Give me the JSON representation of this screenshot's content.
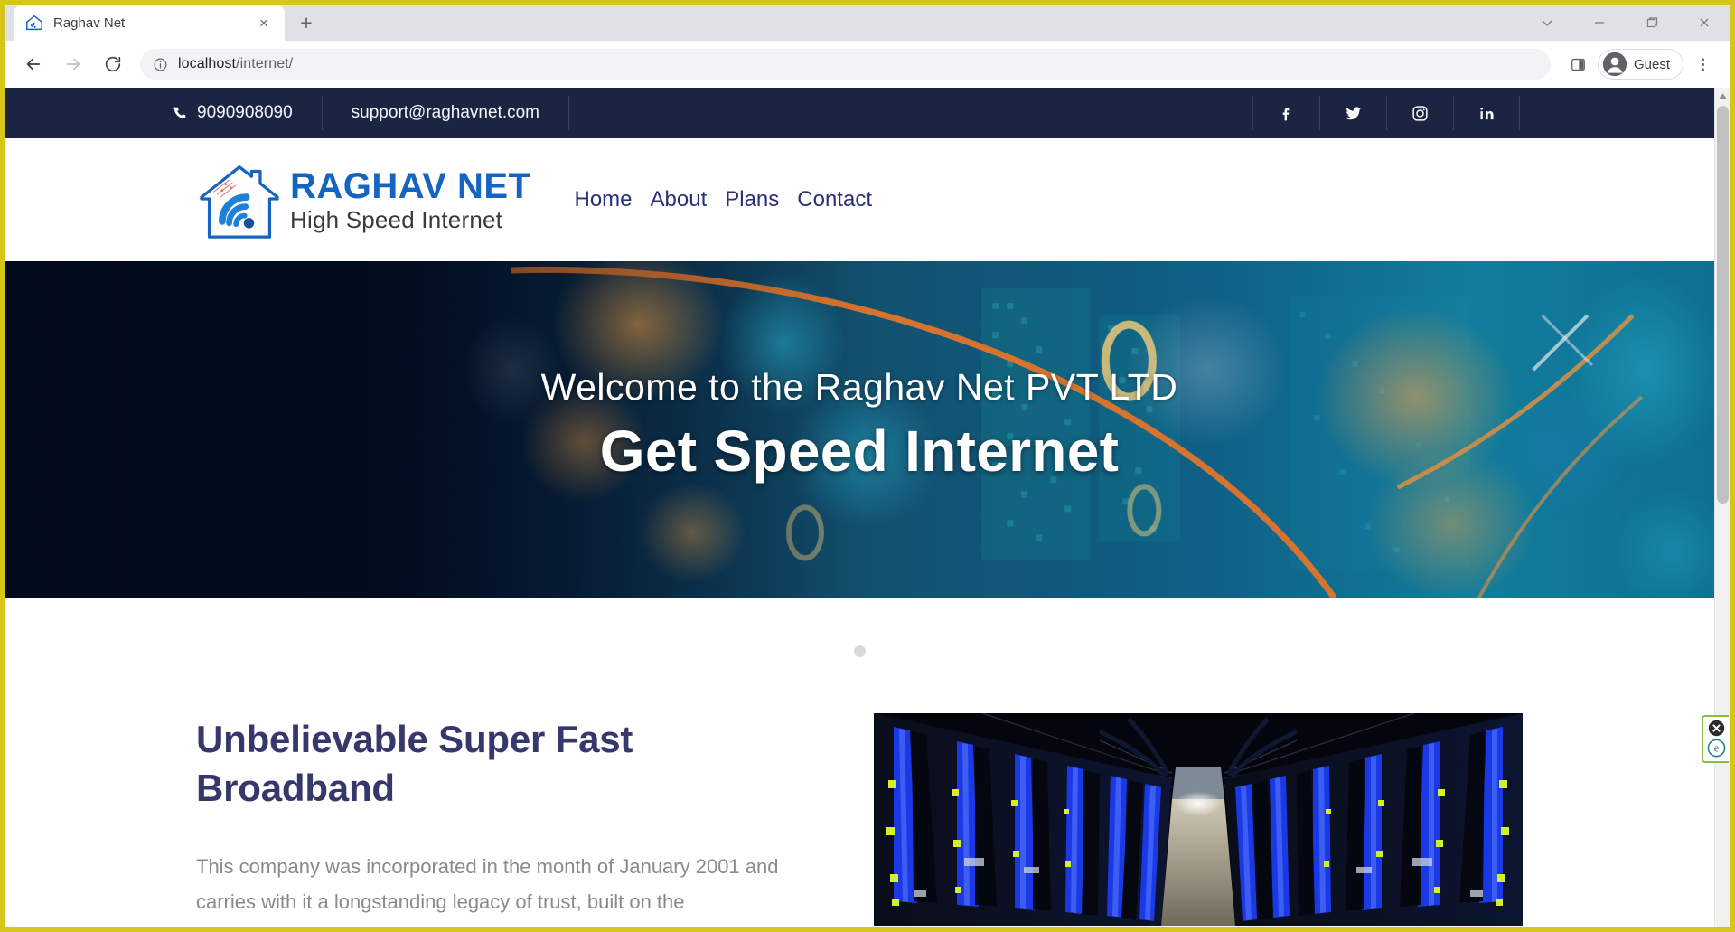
{
  "browser": {
    "tab": {
      "title": "Raghav Net",
      "favicon": "house-wifi-icon",
      "close": "×"
    },
    "new_tab_label": "+",
    "window_controls": {
      "minimize_group": "chevron-down",
      "minimize": "minimize",
      "maximize": "maximize",
      "close": "close"
    },
    "nav": {
      "back": "back-arrow",
      "forward": "forward-arrow",
      "reload": "reload-arrow"
    },
    "omnibox": {
      "info_icon": "info-circle-icon",
      "url_host": "localhost",
      "url_path": "/internet/",
      "url_full": "localhost/internet/"
    },
    "side_panel_icon": "side-panel-icon",
    "profile": {
      "label": "Guest",
      "avatar": "person-avatar"
    },
    "menu_icon": "three-dot-menu-icon"
  },
  "site": {
    "topbar": {
      "phone": "9090908090",
      "phone_icon": "phone-icon",
      "email": "support@raghavnet.com",
      "socials": [
        {
          "name": "facebook",
          "glyph": "f"
        },
        {
          "name": "twitter",
          "glyph": "twitter-bird"
        },
        {
          "name": "instagram",
          "glyph": "instagram-camera"
        },
        {
          "name": "linkedin",
          "glyph": "in"
        }
      ]
    },
    "logo": {
      "icon": "house-wifi-logo-icon",
      "main": "RAGHAV NET",
      "sub": "High Speed Internet"
    },
    "nav": [
      {
        "label": "Home"
      },
      {
        "label": "About"
      },
      {
        "label": "Plans"
      },
      {
        "label": "Contact"
      }
    ],
    "hero": {
      "subtitle": "Welcome to the Raghav Net PVT LTD",
      "title": "Get Speed Internet",
      "background": "technology-bokeh-network-image"
    },
    "carousel": {
      "dots": 1,
      "active": 0
    },
    "about": {
      "heading": "Unbelievable Super Fast Broadband",
      "paragraph": "This company was incorporated in the month of January 2001 and carries with it a longstanding legacy of trust, built on the",
      "image": "data-center-server-racks-image"
    },
    "widget": {
      "close_icon": "close-circle-icon",
      "brand_icon": "e-circle-icon"
    }
  },
  "colors": {
    "topbar_navy": "#1b2541",
    "logo_blue": "#1464c0",
    "nav_indigo": "#2b2f77",
    "heading_indigo": "#36376b",
    "body_gray": "#8a8a8a",
    "frame_yellow": "#d8c51c",
    "widget_green": "#8bbf3a"
  }
}
